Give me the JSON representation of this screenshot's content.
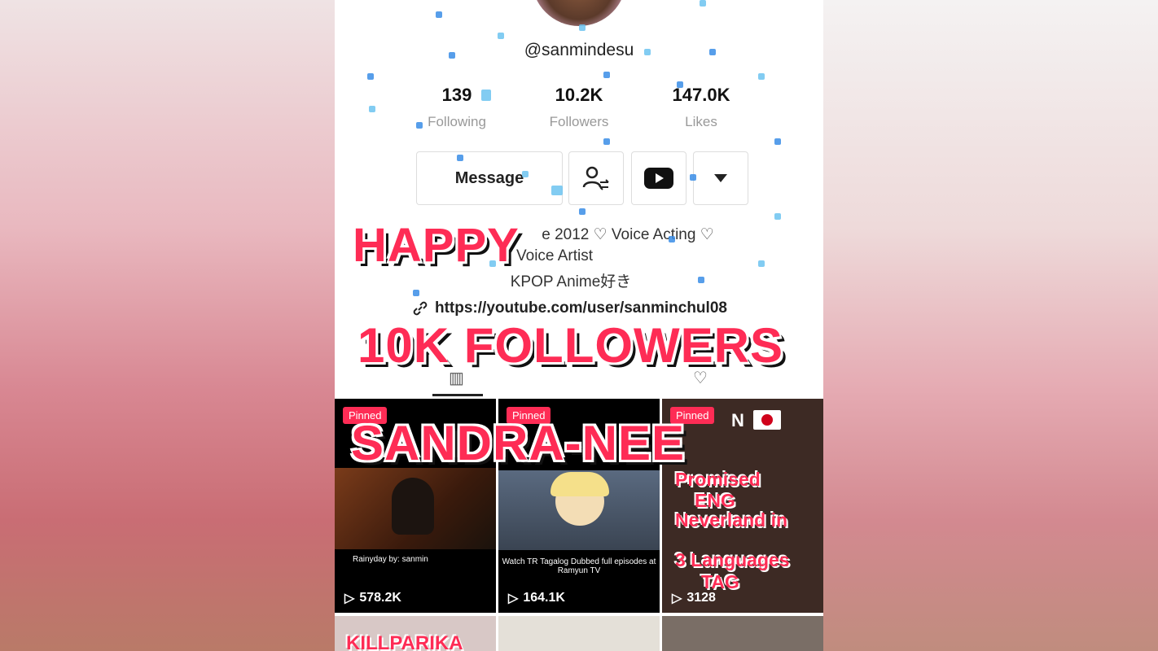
{
  "profile": {
    "handle": "@sanmindesu",
    "stats": [
      {
        "value": "139",
        "label": "Following"
      },
      {
        "value": "10.2K",
        "label": "Followers"
      },
      {
        "value": "147.0K",
        "label": "Likes"
      }
    ],
    "message_label": "Message",
    "bio_line1": "e 2012 ♡ Voice Acting ♡",
    "bio_line2": "Voice Artist",
    "bio_line3": "KPOP Anime好き",
    "link": "https://youtube.com/user/sanminchul08"
  },
  "overlay": {
    "line1": "HAPPY",
    "line2": "10K FOLLOWERS",
    "line3": "SANDRA-NEE"
  },
  "videos": [
    {
      "pinned": "Pinned",
      "views": "578.2K",
      "caption": "Rainyday by: sanmin"
    },
    {
      "pinned": "Pinned",
      "views": "164.1K",
      "caption": "Watch TR Tagalog Dubbed full episodes at Ramyun TV"
    },
    {
      "pinned": "Pinned",
      "views": "3128",
      "text1": "Promised",
      "text2": "ENG",
      "text3": "Neverland in",
      "text4": "3 Languages",
      "text5": "TAG",
      "jp": "N"
    }
  ],
  "row2": {
    "text1": "KILLPARIKA"
  },
  "colors": {
    "accent": "#fe2c55",
    "confetti": "#3a8de6"
  }
}
